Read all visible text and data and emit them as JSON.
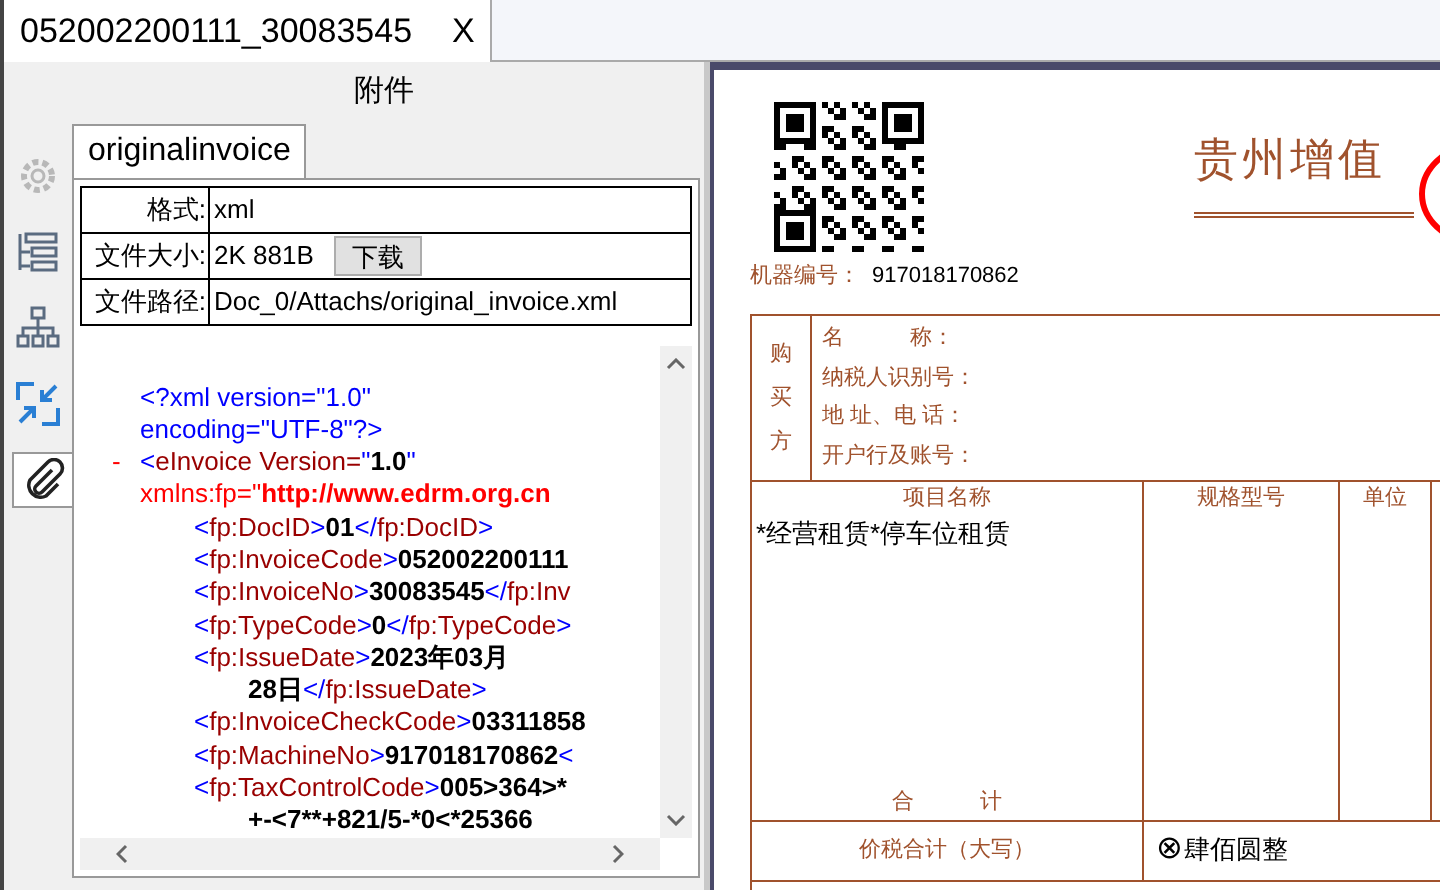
{
  "document_tab": {
    "title": "052002200111_30083545",
    "close": "X",
    "selected": true
  },
  "attachments": {
    "title": "附件",
    "side_tools": [
      {
        "kind": "settings",
        "selected": false
      },
      {
        "kind": "list",
        "selected": false
      },
      {
        "kind": "tree",
        "selected": false
      },
      {
        "kind": "shrink",
        "selected": false
      },
      {
        "kind": "attach",
        "selected": true
      }
    ],
    "file_tab": {
      "label": "originalinvoice",
      "selected": true
    },
    "fields": [
      {
        "label": "格式:",
        "value": "xml"
      },
      {
        "label": "文件大小:",
        "value": "2K 881B",
        "button": "下载"
      },
      {
        "label": "文件路径:",
        "value": "Doc_0/Attachs/original_invoice.xml"
      }
    ],
    "xml_lines": [
      {
        "kind": "decl",
        "segments": [
          {
            "kind": "punct",
            "text": "<?xml version=\"1.0\""
          }
        ]
      },
      {
        "kind": "decl",
        "segments": [
          {
            "kind": "punct",
            "text": "encoding=\"UTF-8\"?>"
          }
        ]
      },
      {
        "kind": "root",
        "marker": "-",
        "segments": [
          {
            "kind": "punct",
            "text": "<"
          },
          {
            "kind": "name",
            "text": "eInvoice Version="
          },
          {
            "kind": "punct",
            "text": "\""
          },
          {
            "kind": "value",
            "text": "1.0"
          },
          {
            "kind": "punct",
            "text": "\""
          }
        ]
      },
      {
        "kind": "root",
        "segments": [
          {
            "kind": "ns",
            "text": "xmlns:fp=\""
          },
          {
            "kind": "nsvalue",
            "text": "http://www.edrm.org.cn"
          }
        ]
      },
      {
        "kind": "child",
        "segments": [
          {
            "kind": "punct",
            "text": "<"
          },
          {
            "kind": "name",
            "text": "fp:DocID"
          },
          {
            "kind": "punct",
            "text": ">"
          },
          {
            "kind": "value",
            "text": "01"
          },
          {
            "kind": "punct",
            "text": "</"
          },
          {
            "kind": "name",
            "text": "fp:DocID"
          },
          {
            "kind": "punct",
            "text": ">"
          }
        ]
      },
      {
        "kind": "child",
        "segments": [
          {
            "kind": "punct",
            "text": "<"
          },
          {
            "kind": "name",
            "text": "fp:InvoiceCode"
          },
          {
            "kind": "punct",
            "text": ">"
          },
          {
            "kind": "value",
            "text": "052002200111"
          }
        ]
      },
      {
        "kind": "child",
        "segments": [
          {
            "kind": "punct",
            "text": "<"
          },
          {
            "kind": "name",
            "text": "fp:InvoiceNo"
          },
          {
            "kind": "punct",
            "text": ">"
          },
          {
            "kind": "value",
            "text": "30083545"
          },
          {
            "kind": "punct",
            "text": "</"
          },
          {
            "kind": "name",
            "text": "fp:Inv"
          }
        ]
      },
      {
        "kind": "child",
        "segments": [
          {
            "kind": "punct",
            "text": "<"
          },
          {
            "kind": "name",
            "text": "fp:TypeCode"
          },
          {
            "kind": "punct",
            "text": ">"
          },
          {
            "kind": "value",
            "text": "0"
          },
          {
            "kind": "punct",
            "text": "</"
          },
          {
            "kind": "name",
            "text": "fp:TypeCode"
          },
          {
            "kind": "punct",
            "text": ">"
          }
        ]
      },
      {
        "kind": "child",
        "segments": [
          {
            "kind": "punct",
            "text": "<"
          },
          {
            "kind": "name",
            "text": "fp:IssueDate"
          },
          {
            "kind": "punct",
            "text": ">"
          },
          {
            "kind": "value",
            "text": "2023年03月"
          }
        ]
      },
      {
        "kind": "wrap",
        "segments": [
          {
            "kind": "value",
            "text": "28日"
          },
          {
            "kind": "punct",
            "text": "</"
          },
          {
            "kind": "name",
            "text": "fp:IssueDate"
          },
          {
            "kind": "punct",
            "text": ">"
          }
        ]
      },
      {
        "kind": "child",
        "segments": [
          {
            "kind": "punct",
            "text": "<"
          },
          {
            "kind": "name",
            "text": "fp:InvoiceCheckCode"
          },
          {
            "kind": "punct",
            "text": ">"
          },
          {
            "kind": "value",
            "text": "03311858"
          }
        ]
      },
      {
        "kind": "child",
        "segments": [
          {
            "kind": "punct",
            "text": "<"
          },
          {
            "kind": "name",
            "text": "fp:MachineNo"
          },
          {
            "kind": "punct",
            "text": ">"
          },
          {
            "kind": "value",
            "text": "917018170862"
          },
          {
            "kind": "punct",
            "text": "<"
          }
        ]
      },
      {
        "kind": "child",
        "segments": [
          {
            "kind": "punct",
            "text": "<"
          },
          {
            "kind": "name",
            "text": "fp:TaxControlCode"
          },
          {
            "kind": "punct",
            "text": ">"
          },
          {
            "kind": "value",
            "text": "005>364>*"
          }
        ]
      },
      {
        "kind": "wrap",
        "segments": [
          {
            "kind": "value",
            "text": "+-<7**+821/5-*0<*25366"
          }
        ]
      }
    ]
  },
  "invoice": {
    "title": "贵州增值",
    "machine_no_label": "机器编号：",
    "machine_no": "917018170862",
    "buyer_label": "购买方",
    "buyer_fields": [
      "名　　　称：",
      "纳税人识别号：",
      "地 址、电 话：",
      "开户行及账号："
    ],
    "columns": [
      "项目名称",
      "规格型号",
      "单位"
    ],
    "items": [
      "*经营租赁*停车位租赁"
    ],
    "total_label": "合　　　计",
    "grand_total_label": "价税合计（大写）",
    "grand_total_mark": "⊗",
    "grand_total": "肆佰圆整"
  }
}
